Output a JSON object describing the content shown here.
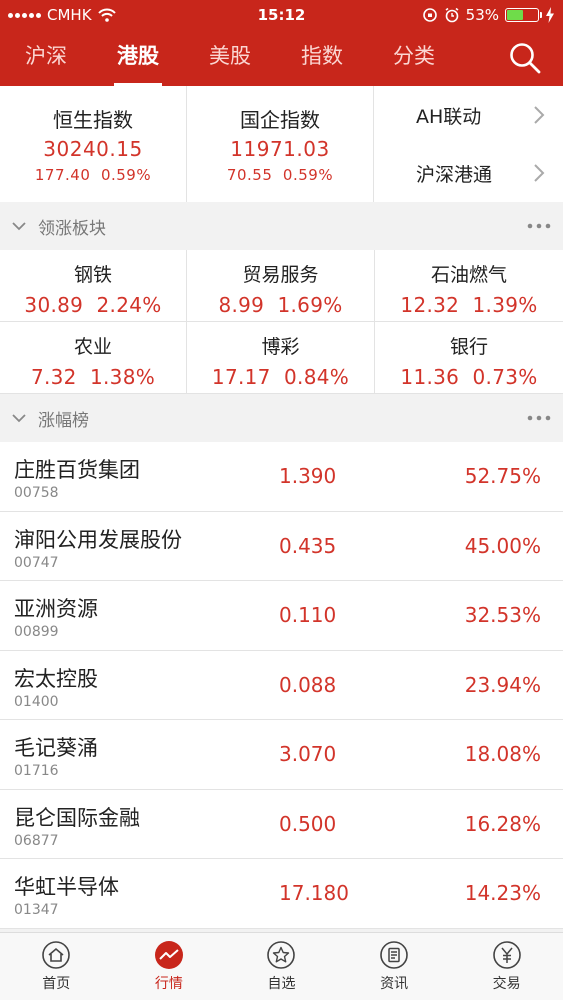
{
  "status_bar": {
    "carrier": "CMHK",
    "time": "15:12",
    "battery": "53%",
    "battery_level": 0.53
  },
  "top_tabs": [
    {
      "label": "沪深",
      "active": false
    },
    {
      "label": "港股",
      "active": true
    },
    {
      "label": "美股",
      "active": false
    },
    {
      "label": "指数",
      "active": false
    },
    {
      "label": "分类",
      "active": false
    }
  ],
  "indices": [
    {
      "name": "恒生指数",
      "value": "30240.15",
      "change": "177.40",
      "pct": "0.59%"
    },
    {
      "name": "国企指数",
      "value": "11971.03",
      "change": "70.55",
      "pct": "0.59%"
    }
  ],
  "links": [
    {
      "label": "AH联动"
    },
    {
      "label": "沪深港通"
    }
  ],
  "sections": {
    "sectors_title": "领涨板块",
    "gainers_title": "涨幅榜"
  },
  "sectors": [
    {
      "name": "钢铁",
      "value": "30.89",
      "pct": "2.24%"
    },
    {
      "name": "贸易服务",
      "value": "8.99",
      "pct": "1.69%"
    },
    {
      "name": "石油燃气",
      "value": "12.32",
      "pct": "1.39%"
    },
    {
      "name": "农业",
      "value": "7.32",
      "pct": "1.38%"
    },
    {
      "name": "博彩",
      "value": "17.17",
      "pct": "0.84%"
    },
    {
      "name": "银行",
      "value": "11.36",
      "pct": "0.73%"
    }
  ],
  "stocks": [
    {
      "name": "庄胜百货集团",
      "code": "00758",
      "price": "1.390",
      "pct": "52.75%"
    },
    {
      "name": "渖阳公用发展股份",
      "code": "00747",
      "price": "0.435",
      "pct": "45.00%"
    },
    {
      "name": "亚洲资源",
      "code": "00899",
      "price": "0.110",
      "pct": "32.53%"
    },
    {
      "name": "宏太控股",
      "code": "01400",
      "price": "0.088",
      "pct": "23.94%"
    },
    {
      "name": "毛记葵涌",
      "code": "01716",
      "price": "3.070",
      "pct": "18.08%"
    },
    {
      "name": "昆仑国际金融",
      "code": "06877",
      "price": "0.500",
      "pct": "16.28%"
    },
    {
      "name": "华虹半导体",
      "code": "01347",
      "price": "17.180",
      "pct": "14.23%"
    }
  ],
  "bottom_nav": [
    {
      "label": "首页",
      "icon": "home-icon",
      "active": false
    },
    {
      "label": "行情",
      "icon": "market-chart-icon",
      "active": true
    },
    {
      "label": "自选",
      "icon": "star-icon",
      "active": false
    },
    {
      "label": "资讯",
      "icon": "news-icon",
      "active": false
    },
    {
      "label": "交易",
      "icon": "trade-yuan-icon",
      "active": false
    }
  ],
  "colors": {
    "brand_red": "#c8261b",
    "up_red": "#d2342a",
    "battery_green": "#6fdc4a"
  }
}
